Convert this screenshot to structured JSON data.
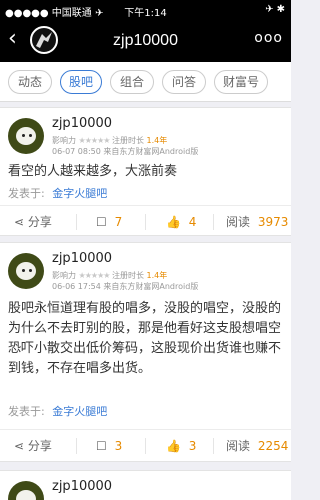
{
  "status": {
    "carrier": "●●●●● 中国联通 ✈",
    "time": "下午1:14",
    "right": "✈ ✱"
  },
  "nav": {
    "back": "‹",
    "title": "zjp10000",
    "more": "ooo"
  },
  "tabs": [
    {
      "label": "动态",
      "active": false
    },
    {
      "label": "股吧",
      "active": true
    },
    {
      "label": "组合",
      "active": false
    },
    {
      "label": "问答",
      "active": false
    },
    {
      "label": "财富号",
      "active": false
    }
  ],
  "posts": [
    {
      "name": "zjp10000",
      "influence_label": "影响力",
      "stars": "★★★★★",
      "reg_label": "注册时长",
      "reg_years": "1.4年",
      "meta": "06-07 08:50 来自东方财富网Android版",
      "content": "看空的人越来越多，大涨前奏",
      "from_label": "发表于:",
      "forum": "金字火腿吧",
      "share": "分享",
      "comments": "7",
      "likes": "4",
      "read_label": "阅读",
      "reads": "3973"
    },
    {
      "name": "zjp10000",
      "influence_label": "影响力",
      "stars": "★★★★★",
      "reg_label": "注册时长",
      "reg_years": "1.4年",
      "meta": "06-06 17:54 来自东方财富网Android版",
      "content": "股吧永恒道理有股的唱多，没股的唱空，没股的为什么不去盯别的股，那是他看好这支股想唱空恐吓小散交出低价筹码，这股现价出货谁也赚不到钱，不存在唱多出货。",
      "from_label": "发表于:",
      "forum": "金字火腿吧",
      "share": "分享",
      "comments": "3",
      "likes": "3",
      "read_label": "阅读",
      "reads": "2254"
    },
    {
      "name": "zjp10000"
    }
  ]
}
